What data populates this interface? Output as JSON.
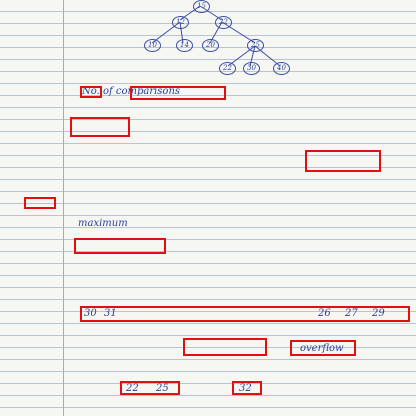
{
  "tree": {
    "nodes": [
      "15",
      "12",
      "22",
      "10",
      "14",
      "20",
      "25",
      "22",
      "30",
      "40"
    ]
  },
  "legible_text": {
    "comparisons_label": "No. of comparisons",
    "maximum_label": "maximum",
    "overflow_label": "overflow"
  },
  "number_row": [
    "30",
    "31",
    "26",
    "27",
    "29"
  ],
  "bottom_row": [
    "22",
    "25",
    "32"
  ],
  "colors": {
    "ink": "#2a3f9a",
    "annotation_box": "#e01010",
    "ruling": "#b9c3d6"
  }
}
